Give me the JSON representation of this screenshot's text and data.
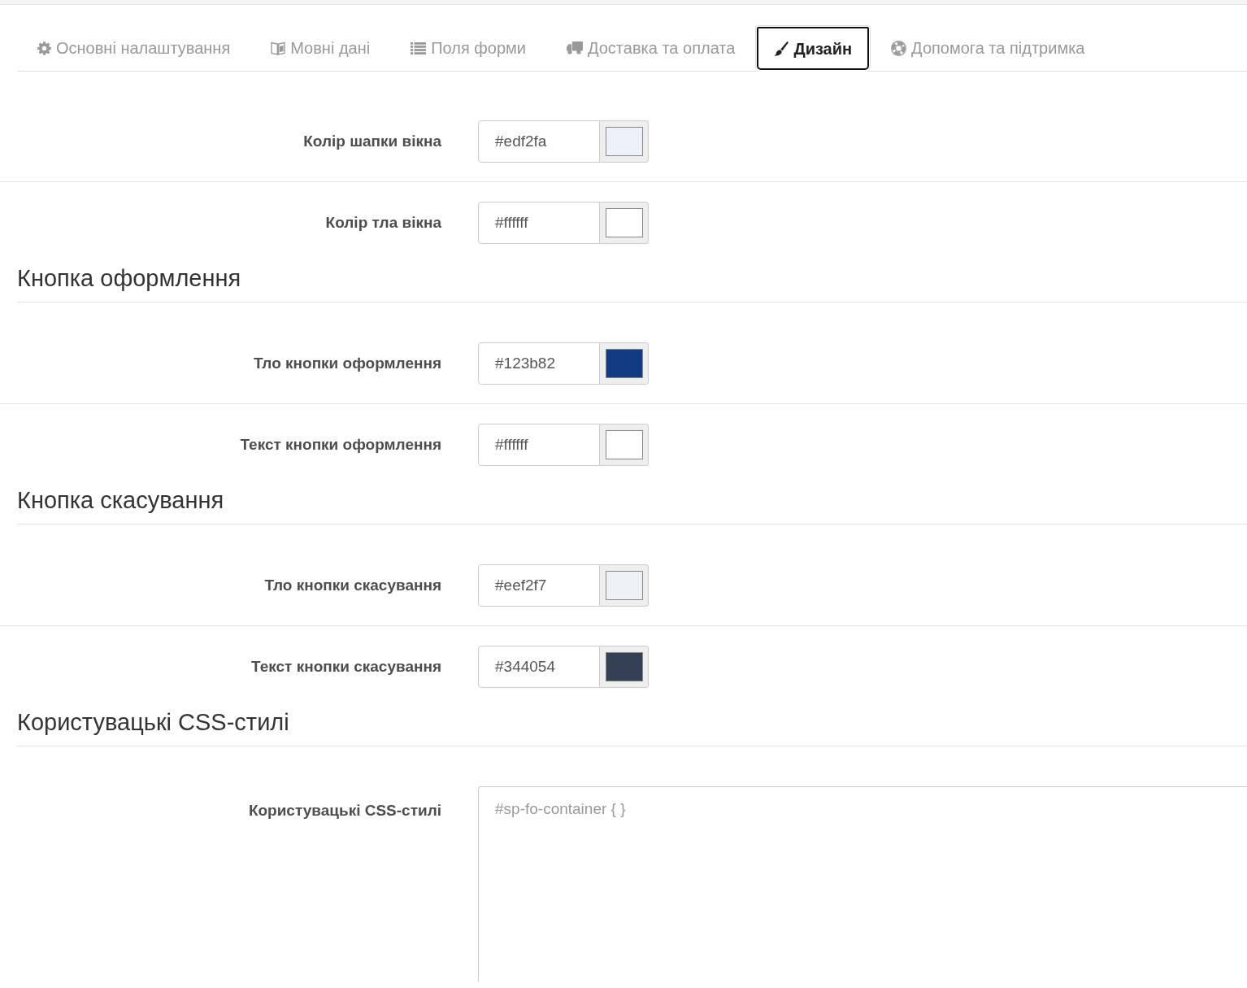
{
  "tabs": [
    {
      "label": "Основні налаштування",
      "selected": false
    },
    {
      "label": "Мовні дані",
      "selected": false
    },
    {
      "label": "Поля форми",
      "selected": false
    },
    {
      "label": "Доставка та оплата",
      "selected": false
    },
    {
      "label": "Дизайн",
      "selected": true
    },
    {
      "label": "Допомога та підтримка",
      "selected": false
    }
  ],
  "sections": [
    {
      "fields": [
        {
          "kind": "color",
          "label": "Колір шапки вікна",
          "value": "#edf2fa",
          "color": "#edf2fa"
        },
        {
          "kind": "color",
          "label": "Колір тла вікна",
          "value": "#ffffff",
          "color": "#ffffff"
        }
      ]
    },
    {
      "heading": "Кнопка оформлення",
      "fields": [
        {
          "kind": "color",
          "label": "Тло кнопки оформлення",
          "value": "#123b82",
          "color": "#123b82"
        },
        {
          "kind": "color",
          "label": "Текст кнопки оформлення",
          "value": "#ffffff",
          "color": "#ffffff"
        }
      ]
    },
    {
      "heading": "Кнопка скасування",
      "fields": [
        {
          "kind": "color",
          "label": "Тло кнопки скасування",
          "value": "#eef2f7",
          "color": "#eef2f7"
        },
        {
          "kind": "color",
          "label": "Текст кнопки скасування",
          "value": "#344054",
          "color": "#344054"
        }
      ]
    },
    {
      "heading": "Користувацькі CSS-стилі",
      "fields": [
        {
          "kind": "textarea",
          "label": "Користувацькі CSS-стилі",
          "placeholder": "#sp-fo-container { }"
        }
      ]
    }
  ]
}
